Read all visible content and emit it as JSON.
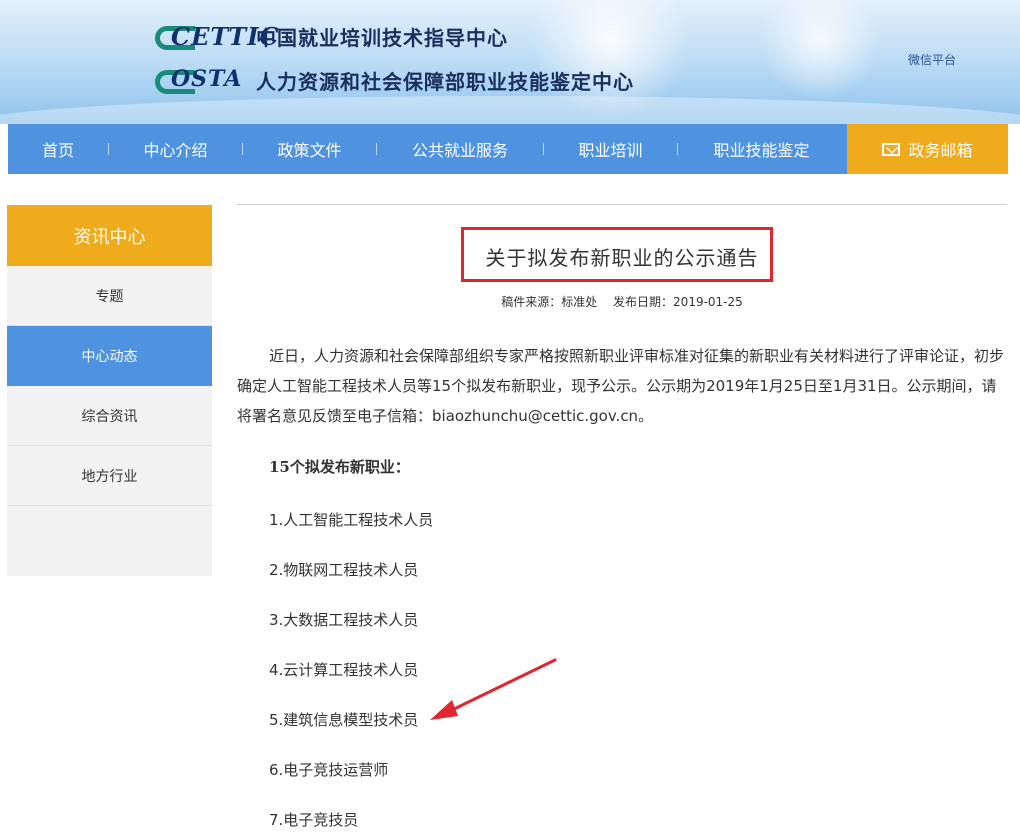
{
  "header": {
    "logo1": "CETTIC",
    "org1": "中国就业培训技术指导中心",
    "logo2": "OSTA",
    "org2": "人力资源和社会保障部职业技能鉴定中心",
    "wechat": "微信平台"
  },
  "nav": {
    "items": [
      "首页",
      "中心介绍",
      "政策文件",
      "公共就业服务",
      "职业培训",
      "职业技能鉴定"
    ],
    "mail": "政务邮箱"
  },
  "sidebar": {
    "title": "资讯中心",
    "items": [
      "专题",
      "中心动态",
      "综合资讯",
      "地方行业"
    ],
    "active_index": 1
  },
  "article": {
    "title": "关于拟发布新职业的公示通告",
    "source": "稿件来源：标准处",
    "date": "发布日期：2019-01-25",
    "body": "近日，人力资源和社会保障部组织专家严格按照新职业评审标准对征集的新职业有关材料进行了评审论证，初步确定人工智能工程技术人员等15个拟发布新职业，现予公示。公示期为2019年1月25日至1月31日。公示期间，请将署名意见反馈至电子信箱：biaozhunchu@cettic.gov.cn。",
    "list_heading": "15个拟发布新职业：",
    "occupations": [
      "1.人工智能工程技术人员",
      "2.物联网工程技术人员",
      "3.大数据工程技术人员",
      "4.云计算工程技术人员",
      "5.建筑信息模型技术员",
      "6.电子竞技运营师",
      "7.电子竞技员"
    ]
  },
  "colors": {
    "nav_blue": "#4f93e0",
    "accent_orange": "#efab1b",
    "highlight_red": "#e0262e"
  }
}
